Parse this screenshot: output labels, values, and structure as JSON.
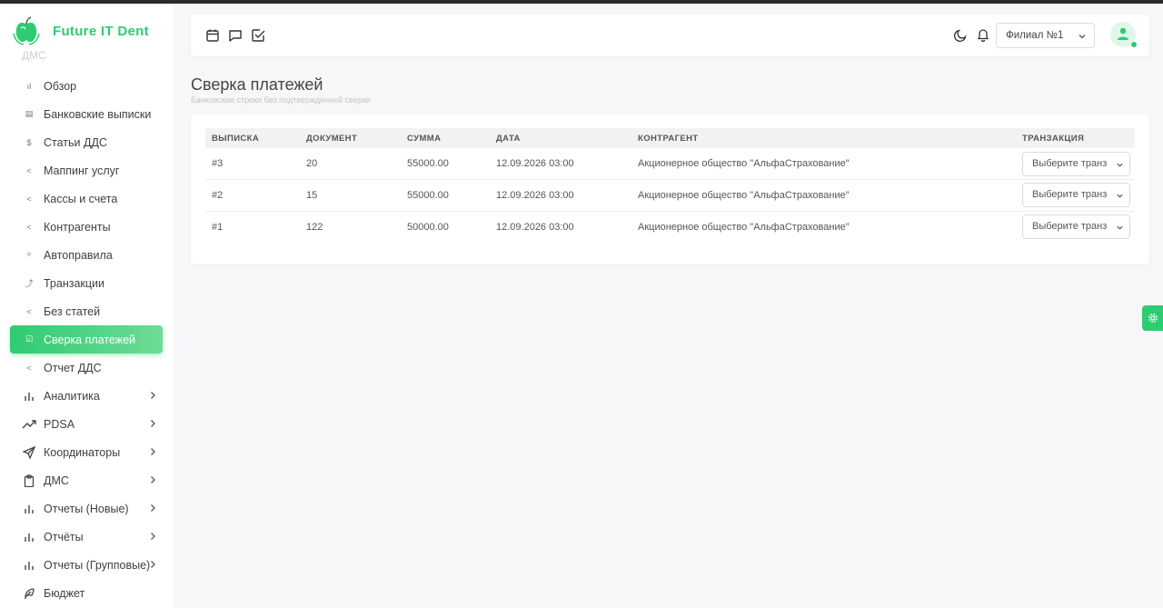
{
  "brand": {
    "name": "Future IT Dent",
    "color": "#2ecc71"
  },
  "sidebar": {
    "ghost_label": "ДМС",
    "items": [
      {
        "label": "Обзор",
        "icon": "bar-chart-small-icon",
        "glyph": "ıl"
      },
      {
        "label": "Банковские выписки",
        "icon": "document-icon",
        "glyph": "▤"
      },
      {
        "label": "Статьи ДДС",
        "icon": "dollar-icon",
        "glyph": "$"
      },
      {
        "label": "Маппинг услуг",
        "icon": "share-icon",
        "glyph": "<"
      },
      {
        "label": "Кассы и счета",
        "icon": "share-icon",
        "glyph": "<"
      },
      {
        "label": "Контрагенты",
        "icon": "share-icon",
        "glyph": "<"
      },
      {
        "label": "Автоправила",
        "icon": "sparkle-icon",
        "glyph": "✧"
      },
      {
        "label": "Транзакции",
        "icon": "transfer-icon",
        "glyph": "⤴"
      },
      {
        "label": "Без статей",
        "icon": "share-icon",
        "glyph": "<"
      },
      {
        "label": "Сверка платежей",
        "icon": "check-square-icon",
        "glyph": "☑",
        "active": true
      },
      {
        "label": "Отчет ДДС",
        "icon": "share-icon",
        "glyph": "<"
      }
    ],
    "groups": [
      {
        "label": "Аналитика",
        "icon": "bar-chart-icon"
      },
      {
        "label": "PDSA",
        "icon": "trending-up-icon"
      },
      {
        "label": "Координаторы",
        "icon": "send-icon"
      },
      {
        "label": "ДМС",
        "icon": "clipboard-icon"
      },
      {
        "label": "Отчеты (Новые)",
        "icon": "bar-chart-icon"
      },
      {
        "label": "Отчёты",
        "icon": "bar-chart-icon"
      },
      {
        "label": "Отчеты (Групповые)",
        "icon": "bar-chart-icon"
      },
      {
        "label": "Бюджет",
        "icon": "feather-icon"
      }
    ]
  },
  "header": {
    "icons": [
      "calendar-icon",
      "chat-icon",
      "checkbox-icon"
    ],
    "branch": "Филиал №1"
  },
  "page": {
    "title": "Сверка платежей",
    "subtitle": "Банковские строки без подтвержденной сверки"
  },
  "table": {
    "columns": [
      "ВЫПИСКА",
      "ДОКУМЕНТ",
      "СУММА",
      "ДАТА",
      "КОНТРАГЕНТ",
      "ТРАНЗАКЦИЯ"
    ],
    "rows": [
      {
        "statement": "#3",
        "document": "20",
        "amount": "55000.00",
        "date": "12.09.2026 03:00",
        "counterparty": "Акционерное общество \"АльфаСтрахование\"",
        "select": "Выберите транз"
      },
      {
        "statement": "#2",
        "document": "15",
        "amount": "55000.00",
        "date": "12.09.2026 03:00",
        "counterparty": "Акционерное общество \"АльфаСтрахование\"",
        "select": "Выберите транз"
      },
      {
        "statement": "#1",
        "document": "122",
        "amount": "50000.00",
        "date": "12.09.2026 03:00",
        "counterparty": "Акционерное общество \"АльфаСтрахование\"",
        "select": "Выберите транз"
      }
    ]
  }
}
